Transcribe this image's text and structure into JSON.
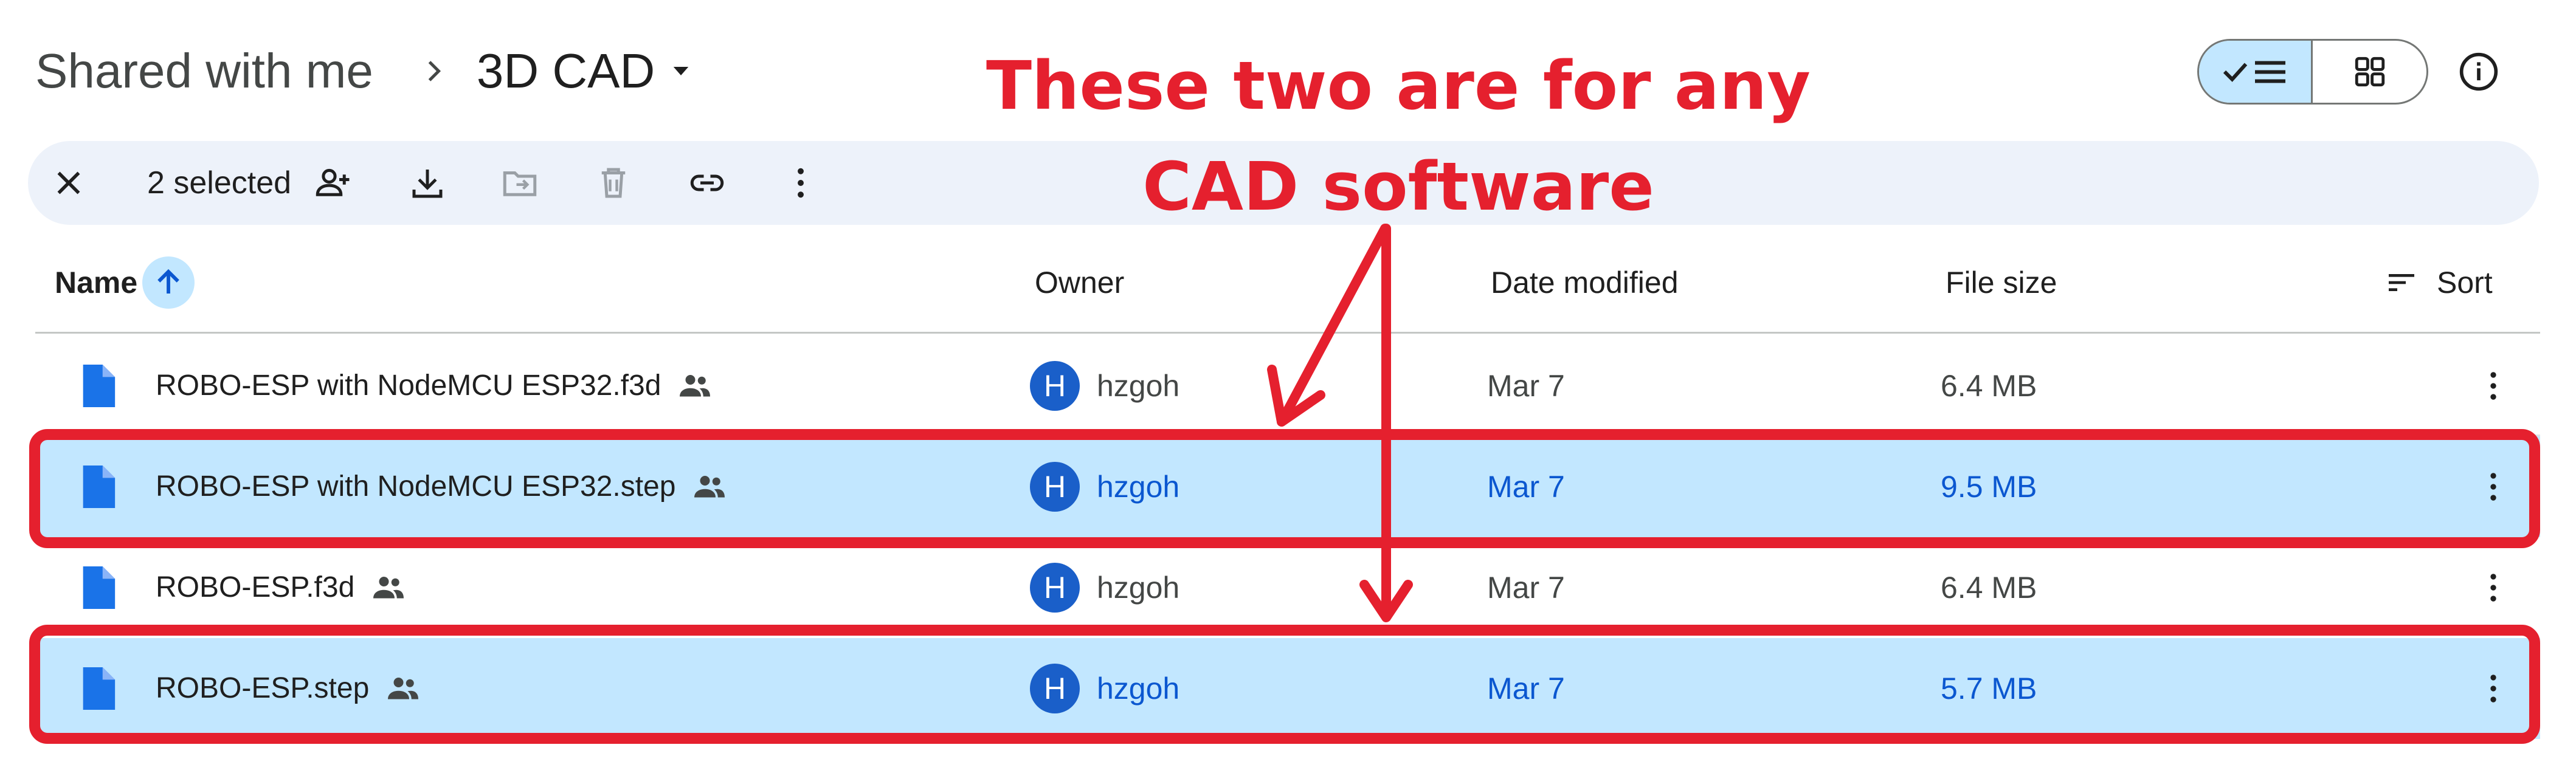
{
  "breadcrumb": {
    "root": "Shared with me",
    "current": "3D CAD"
  },
  "selection_bar": {
    "count_label": "2 selected"
  },
  "columns": {
    "name": "Name",
    "owner": "Owner",
    "date_modified": "Date modified",
    "file_size": "File size",
    "sort": "Sort"
  },
  "files": [
    {
      "name": "ROBO-ESP with NodeMCU ESP32.f3d",
      "owner_initial": "H",
      "owner": "hzgoh",
      "date": "Mar 7",
      "size": "6.4 MB",
      "selected": false
    },
    {
      "name": "ROBO-ESP with NodeMCU ESP32.step",
      "owner_initial": "H",
      "owner": "hzgoh",
      "date": "Mar 7",
      "size": "9.5 MB",
      "selected": true
    },
    {
      "name": "ROBO-ESP.f3d",
      "owner_initial": "H",
      "owner": "hzgoh",
      "date": "Mar 7",
      "size": "6.4 MB",
      "selected": false
    },
    {
      "name": "ROBO-ESP.step",
      "owner_initial": "H",
      "owner": "hzgoh",
      "date": "Mar 7",
      "size": "5.7 MB",
      "selected": true
    }
  ],
  "annotation": {
    "text": "These two are for any CAD software",
    "color": "#e5202e"
  },
  "colors": {
    "selected_row": "#c2e7ff",
    "accent": "#0b57d0",
    "toolbar_bg": "#edf2fa"
  },
  "icons": {
    "clear_selection": "close-icon",
    "share": "person-add-icon",
    "download": "download-icon",
    "move": "folder-move-icon",
    "trash": "trash-icon",
    "link": "link-icon",
    "more": "more-vert-icon",
    "list_view": "check-list-icon",
    "grid_view": "grid-icon",
    "info": "info-icon",
    "file": "file-doc-icon",
    "shared": "people-icon",
    "sort": "sort-lines-icon"
  }
}
